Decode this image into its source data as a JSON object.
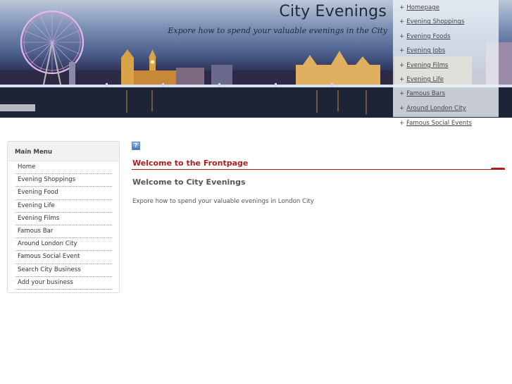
{
  "header": {
    "site_title": "City Evenings",
    "tagline": "Expore how to spend your valuable evenings in the City"
  },
  "top_links": [
    {
      "label": "Homepage"
    },
    {
      "label": "Evening Shoppings"
    },
    {
      "label": "Evening Foods"
    },
    {
      "label": "Evening Jobs"
    },
    {
      "label": "Evening Films"
    },
    {
      "label": "Evening Life"
    },
    {
      "label": "Famous Bars"
    },
    {
      "label": "Around London City"
    },
    {
      "label": "Famous Social Events"
    }
  ],
  "link_prefix": "+",
  "main_menu": {
    "heading": "Main Menu",
    "items": [
      {
        "label": "Home"
      },
      {
        "label": "Evening Shoppings"
      },
      {
        "label": "Evening Food"
      },
      {
        "label": "Evening Life"
      },
      {
        "label": "Evening Films"
      },
      {
        "label": "Famous Bar"
      },
      {
        "label": "Around London City"
      },
      {
        "label": "Famous Social Event"
      },
      {
        "label": "Search City Business"
      },
      {
        "label": "Add your business"
      }
    ]
  },
  "content": {
    "help_icon_glyph": "?",
    "section_heading": "Welcome to the Frontpage",
    "article_title": "Welcome to City Evenings",
    "article_text": "Expore how to spend your valuable evenings in London City"
  },
  "colors": {
    "accent_red": "#b01c1c",
    "link_panel": "#ecf0f6"
  },
  "icons": {
    "help": "help-icon"
  }
}
